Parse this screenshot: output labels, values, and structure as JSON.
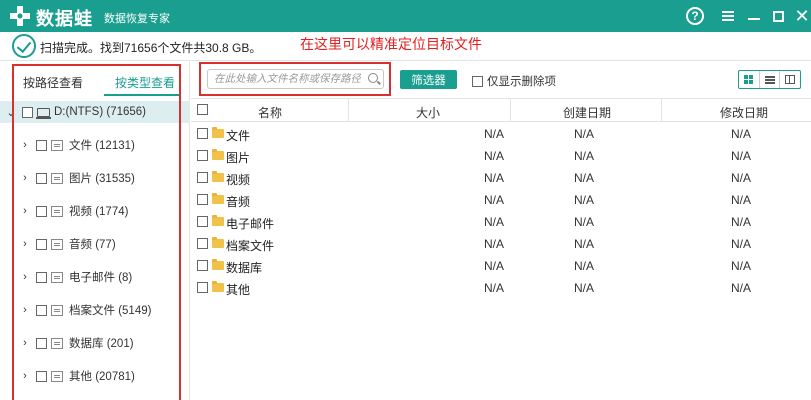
{
  "titlebar": {
    "brand": "数据蛙",
    "subtitle": "数据恢复专家",
    "help_glyph": "?",
    "close_glyph": "✕",
    "bg_color": "#1a9e8f"
  },
  "status": {
    "text": "扫描完成。找到71656个文件共30.8 GB。"
  },
  "annotation": {
    "text": "在这里可以精准定位目标文件",
    "color": "#e02020"
  },
  "sidebar": {
    "tabs": [
      {
        "label": "按路径查看"
      },
      {
        "label": "按类型查看"
      }
    ],
    "root": {
      "label": "D:(NTFS) (71656)"
    },
    "items": [
      {
        "label": "文件 (12131)",
        "icon": "document-icon"
      },
      {
        "label": "图片 (31535)",
        "icon": "image-icon"
      },
      {
        "label": "视频 (1774)",
        "icon": "video-icon"
      },
      {
        "label": "音频 (77)",
        "icon": "audio-icon"
      },
      {
        "label": "电子邮件 (8)",
        "icon": "email-icon"
      },
      {
        "label": "档案文件 (5149)",
        "icon": "archive-icon"
      },
      {
        "label": "数据库 (201)",
        "icon": "database-icon"
      },
      {
        "label": "其他 (20781)",
        "icon": "other-icon"
      }
    ]
  },
  "toolbar": {
    "search_placeholder": "在此处输入文件名称或保存路径",
    "filter_label": "筛选器",
    "deleted_only_label": "仅显示删除项"
  },
  "table": {
    "headers": [
      "名称",
      "大小",
      "创建日期",
      "修改日期"
    ],
    "rows": [
      {
        "name": "文件",
        "size": "N/A",
        "created": "N/A",
        "modified": "N/A"
      },
      {
        "name": "图片",
        "size": "N/A",
        "created": "N/A",
        "modified": "N/A"
      },
      {
        "name": "视频",
        "size": "N/A",
        "created": "N/A",
        "modified": "N/A"
      },
      {
        "name": "音频",
        "size": "N/A",
        "created": "N/A",
        "modified": "N/A"
      },
      {
        "name": "电子邮件",
        "size": "N/A",
        "created": "N/A",
        "modified": "N/A"
      },
      {
        "name": "档案文件",
        "size": "N/A",
        "created": "N/A",
        "modified": "N/A"
      },
      {
        "name": "数据库",
        "size": "N/A",
        "created": "N/A",
        "modified": "N/A"
      },
      {
        "name": "其他",
        "size": "N/A",
        "created": "N/A",
        "modified": "N/A"
      }
    ]
  }
}
